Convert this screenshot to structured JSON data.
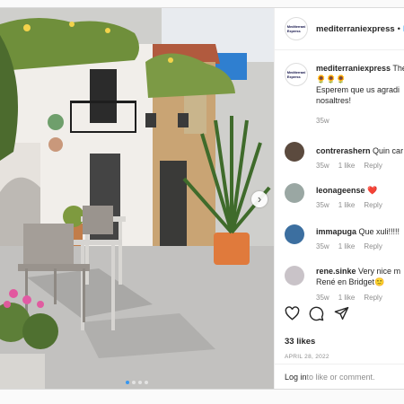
{
  "header": {
    "logo_text": "mediterraniexpress",
    "username": "mediterraniexpress",
    "separator": "•",
    "follow_label": "F"
  },
  "caption": {
    "username": "mediterraniexpress",
    "line1": "The",
    "line2": "🌻🌻🌻",
    "line3": "Esperem que us agradi",
    "line4": "nosaltres!",
    "age": "35w"
  },
  "comments": [
    {
      "username": "contrerashern",
      "text": "Quin car",
      "age": "35w",
      "likes": "1 like",
      "reply": "Reply"
    },
    {
      "username": "leonageense",
      "text": "❤️",
      "age": "35w",
      "likes": "1 like",
      "reply": "Reply"
    },
    {
      "username": "immapuga",
      "text": "Que xuli!!!!!",
      "age": "35w",
      "likes": "1 like",
      "reply": "Reply"
    },
    {
      "username": "rene.sinke",
      "text": "Very nice m",
      "text2": "René en Bridget🙂",
      "age": "35w",
      "likes": "1 like",
      "reply": "Reply"
    }
  ],
  "likes_count": "33 likes",
  "post_date": "APRIL 28, 2022",
  "login": {
    "link": "Log in",
    "rest": " to like or comment."
  },
  "carousel": {
    "next_glyph": "›"
  },
  "icons": [
    "heart-icon",
    "comment-icon",
    "share-icon",
    "chevron-right-icon"
  ],
  "colors": {
    "link_blue": "#0095f6",
    "text": "#262626",
    "muted": "#8e8e8e",
    "dot_active": "#3897f0"
  }
}
